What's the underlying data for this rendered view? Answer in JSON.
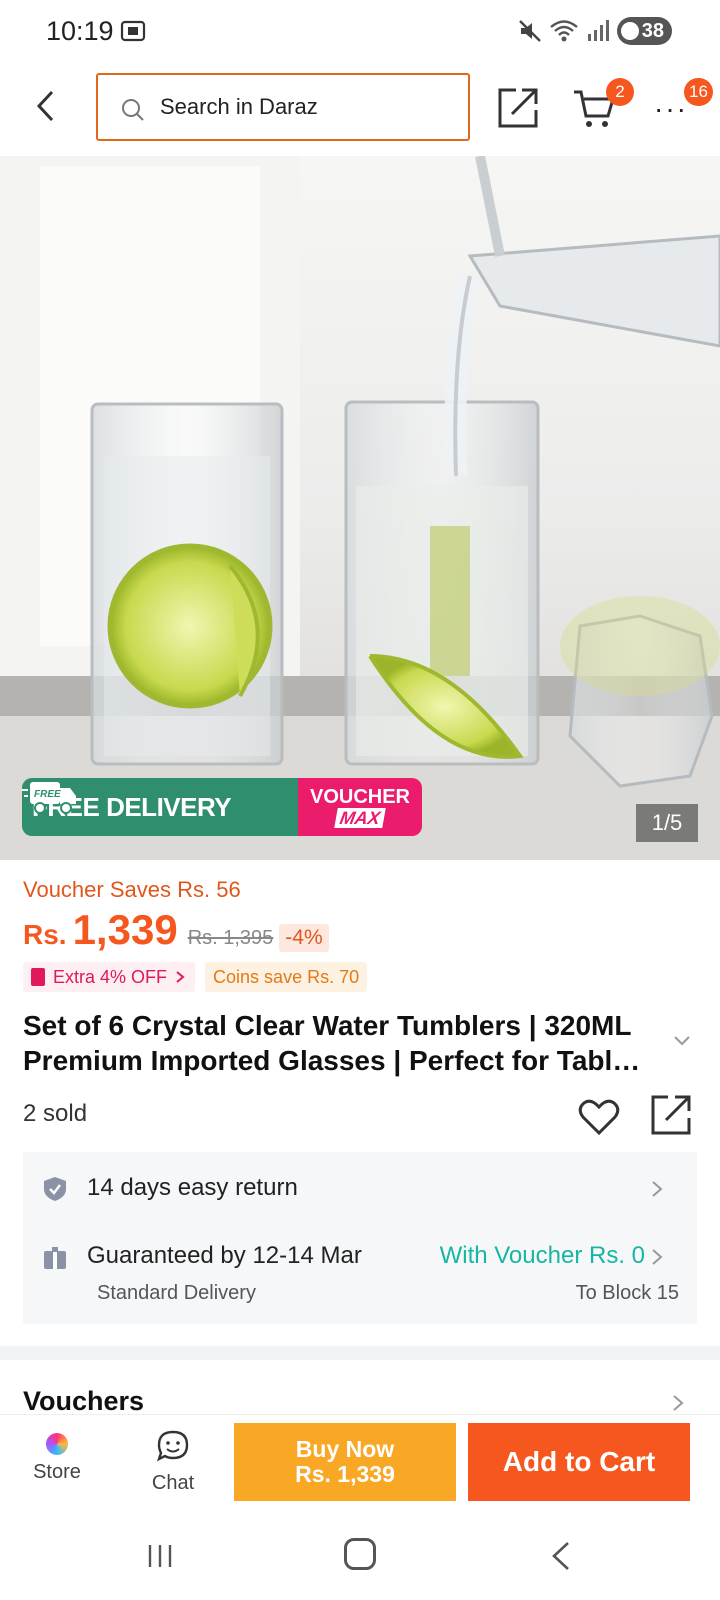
{
  "status_bar": {
    "time": "10:19",
    "battery": "38",
    "icons": [
      "screenshot-icon",
      "mute-icon",
      "wifi-icon",
      "signal-icon",
      "battery-icon"
    ]
  },
  "top_nav": {
    "search_placeholder": "Search in Daraz",
    "cart_badge": "2",
    "more_badge": "16"
  },
  "hero": {
    "promo_free_delivery": "FREE DELIVERY",
    "promo_truck_text": "FREE",
    "promo_voucher_line1": "VOUCHER",
    "promo_voucher_line2": "MAX",
    "page_counter": "1/5"
  },
  "product": {
    "voucher_saves": "Voucher Saves Rs. 56",
    "currency": "Rs.",
    "price": "1,339",
    "old_price": "Rs. 1,395",
    "discount": "-4%",
    "extra_off": "Extra 4% OFF",
    "coins_save": "Coins save Rs. 70",
    "title": "Set of 6 Crystal Clear Water Tumblers | 320ML Premium Imported Glasses | Perfect for Table, Office & Home Use",
    "sold": "2 sold"
  },
  "delivery": {
    "return_text": "14 days easy return",
    "guarantee_text": "Guaranteed by 12-14 Mar",
    "voucher_text": "With Voucher Rs. 0",
    "method": "Standard Delivery",
    "location": "To Block 15"
  },
  "vouchers": {
    "title": "Vouchers"
  },
  "action_bar": {
    "store_label": "Store",
    "chat_label": "Chat",
    "buy_now_line1": "Buy Now",
    "buy_now_line2": "Rs. 1,339",
    "add_to_cart": "Add to Cart"
  },
  "colors": {
    "accent": "#f5571f",
    "buy_now": "#f9a825",
    "free_delivery": "#2f8e6e",
    "voucher_max": "#ea1c6b",
    "teal": "#17b6a3"
  }
}
